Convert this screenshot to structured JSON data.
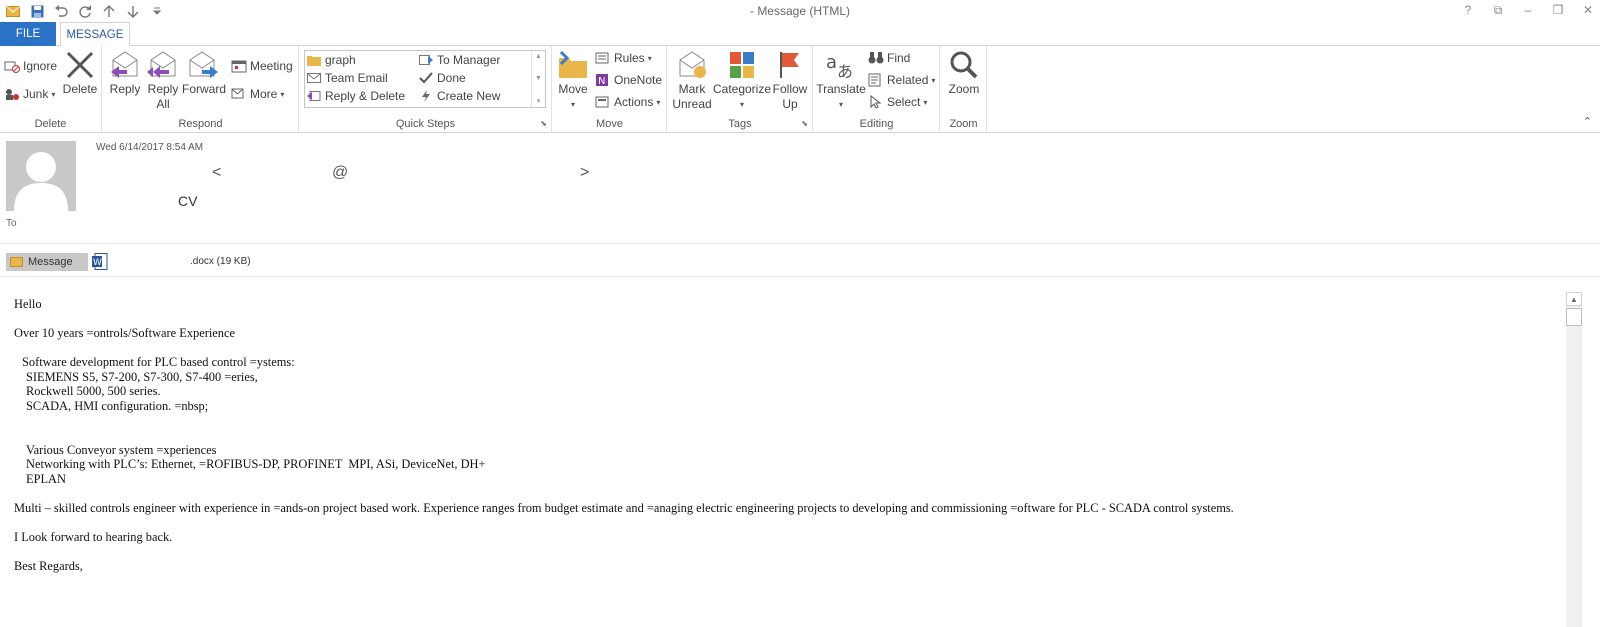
{
  "window": {
    "title": "- Message (HTML)",
    "controls": [
      "?",
      "⧉",
      "–",
      "❐",
      "✕"
    ]
  },
  "tabs": [
    {
      "label": "FILE"
    },
    {
      "label": "MESSAGE"
    }
  ],
  "ribbon": {
    "delete_group": {
      "label": "Delete",
      "ignore": "Ignore",
      "junk": "Junk",
      "delete": "Delete"
    },
    "respond_group": {
      "label": "Respond",
      "reply": "Reply",
      "reply_all_1": "Reply",
      "reply_all_2": "All",
      "forward": "Forward",
      "meeting": "Meeting",
      "more": "More"
    },
    "quick_steps": {
      "label": "Quick Steps",
      "items": [
        "graph",
        "Team Email",
        "Reply & Delete",
        "To Manager",
        "Done",
        "Create New"
      ]
    },
    "move_group": {
      "label": "Move",
      "move": "Move",
      "rules": "Rules",
      "onenote": "OneNote",
      "actions": "Actions"
    },
    "tags_group": {
      "label": "Tags",
      "mark_unread_1": "Mark",
      "mark_unread_2": "Unread",
      "categorize": "Categorize",
      "follow_up_1": "Follow",
      "follow_up_2": "Up"
    },
    "editing_group": {
      "label": "Editing",
      "translate": "Translate",
      "find": "Find",
      "related": "Related",
      "select": "Select"
    },
    "zoom_group": {
      "label": "Zoom",
      "zoom": "Zoom"
    }
  },
  "header": {
    "date": "Wed 6/14/2017 8:54 AM",
    "sender_lt": "<",
    "sender_at": "@",
    "sender_gt": ">",
    "subject": "CV",
    "to_label": "To"
  },
  "attachments": {
    "message_label": "Message",
    "file_label": ".docx (19 KB)"
  },
  "body": {
    "lines": [
      "Hello",
      "Over 10 years =ontrols/Software Experience",
      "Software development for PLC based control =ystems:",
      "SIEMENS S5, S7-200, S7-300, S7-400 =eries,",
      "Rockwell 5000, 500 series.",
      "SCADA, HMI configuration. =nbsp;",
      "Various Conveyor system =xperiences",
      "Networking with PLC’s: Ethernet, =ROFIBUS-DP, PROFINET  MPI, ASi, DeviceNet, DH+",
      "EPLAN",
      "Multi – skilled controls engineer with experience in =ands-on project based work. Experience ranges from budget estimate and =anaging electric engineering projects to developing and commissioning =oftware for PLC - SCADA control systems.",
      "I Look forward to hearing back.",
      "Best Regards,"
    ]
  },
  "colors": {
    "file_tab": "#2b71c6",
    "accent_text": "#2b579a",
    "flag": "#e05a3a",
    "avatar_bg": "#c9c9c9"
  }
}
